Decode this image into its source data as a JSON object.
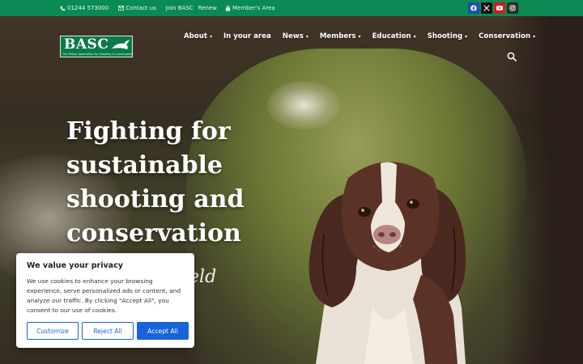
{
  "topbar": {
    "phone": "01244 573000",
    "contact": "Contact us",
    "join": "Join BASC",
    "renew": "Renew",
    "members_area": "Member's Area",
    "background_color": "#0a8a55"
  },
  "social": [
    {
      "name": "facebook-icon",
      "color": "#1e4ea8"
    },
    {
      "name": "x-icon",
      "color": "#111111"
    },
    {
      "name": "youtube-icon",
      "color": "#d21b1b"
    },
    {
      "name": "instagram-icon",
      "color": "#2a2a2a"
    }
  ],
  "logo": {
    "word": "BASC",
    "tagline": "The British Association for Shooting & Conservation"
  },
  "nav": {
    "items": [
      {
        "label": "About",
        "dropdown": true
      },
      {
        "label": "In your area",
        "dropdown": false
      },
      {
        "label": "News",
        "dropdown": true
      },
      {
        "label": "Members",
        "dropdown": true
      },
      {
        "label": "Education",
        "dropdown": true
      },
      {
        "label": "Shooting",
        "dropdown": true
      },
      {
        "label": "Conservation",
        "dropdown": true
      }
    ],
    "search_icon": "search-icon"
  },
  "hero": {
    "headline_lines": [
      "Fighting for",
      "sustainable",
      "shooting and",
      "conservation"
    ],
    "script_text": "ield"
  },
  "cookie": {
    "title": "We value your privacy",
    "body": "We use cookies to enhance your browsing experience, serve personalized ads or content, and analyze our traffic. By clicking \"Accept All\", you consent to our use of cookies.",
    "customize": "Customize",
    "reject": "Reject All",
    "accept": "Accept All",
    "accent_color": "#1863dc"
  }
}
